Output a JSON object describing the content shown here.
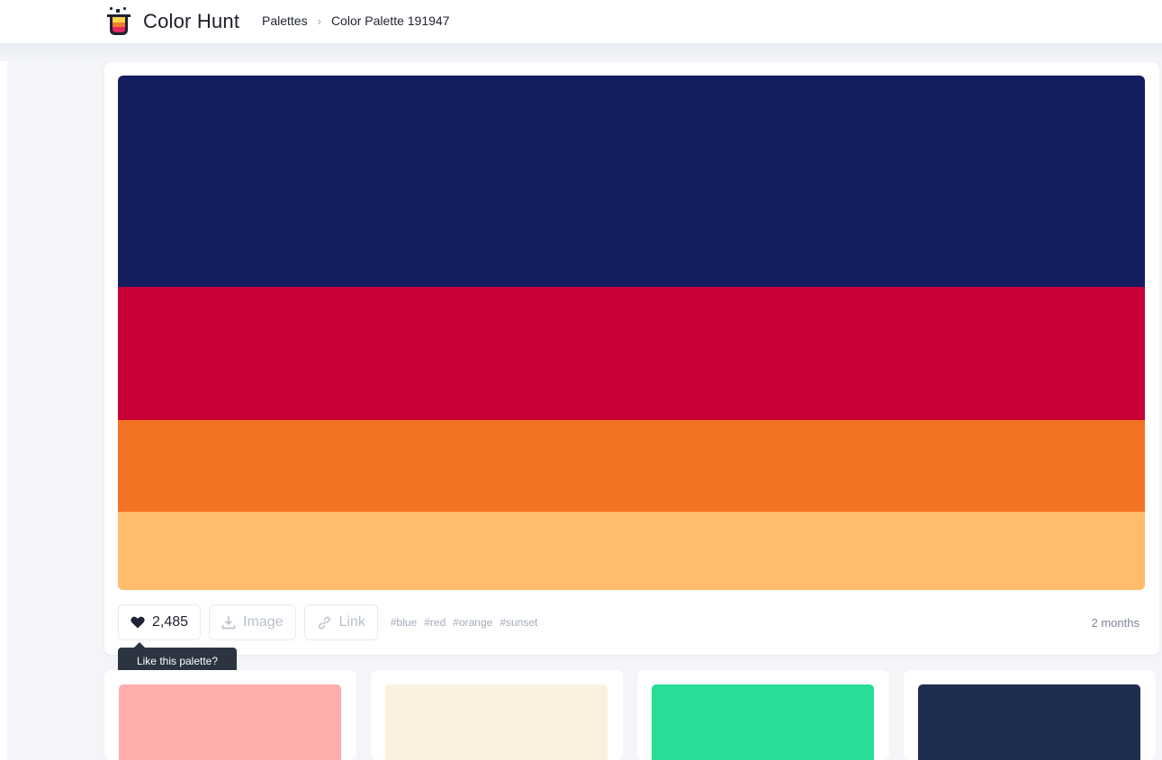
{
  "header": {
    "brand": "Color Hunt",
    "breadcrumb": [
      "Palettes",
      "Color Palette 191947"
    ],
    "separator": "›",
    "logo_icon": "color-hunt-logo-icon"
  },
  "palette": {
    "colors": [
      "#131D5F",
      "#C70038",
      "#F37323",
      "#FFBC6B"
    ]
  },
  "actions": {
    "likes": "2,485",
    "like_icon": "heart-icon",
    "image_label": "Image",
    "image_icon": "download-icon",
    "link_label": "Link",
    "link_icon": "link-icon",
    "tags": [
      "#blue",
      "#red",
      "#orange",
      "#sunset"
    ],
    "age": "2 months"
  },
  "tooltip": "Like this palette?",
  "related_palettes": [
    {
      "top_color": "#FFAEAE"
    },
    {
      "top_color": "#FAF1DF"
    },
    {
      "top_color": "#27DE96"
    },
    {
      "top_color": "#1F2D4E"
    }
  ]
}
